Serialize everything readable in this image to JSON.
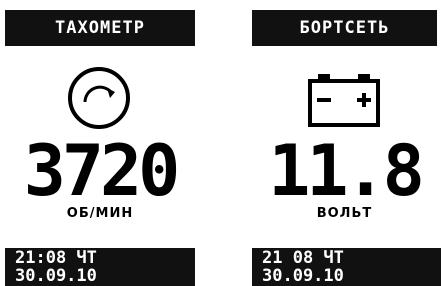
{
  "tachometer": {
    "title": "ТАХОМЕТР",
    "value": "3720",
    "unit": "ОБ/МИН",
    "clock": {
      "line1": "21:08 ЧТ",
      "line2": "30.09.10"
    }
  },
  "voltmeter": {
    "title": "БОРТСЕТЬ",
    "value": "11.8",
    "unit": "ВОЛЬТ",
    "clock": {
      "line1": "21 08 ЧТ",
      "line2": "30.09.10"
    }
  },
  "colors": {
    "background": "#ffffff",
    "bar": "#111111",
    "text": "#000000",
    "bar_text": "#ffffff"
  },
  "icons": {
    "tachometer": "speedometer-icon",
    "voltmeter": "battery-icon"
  }
}
